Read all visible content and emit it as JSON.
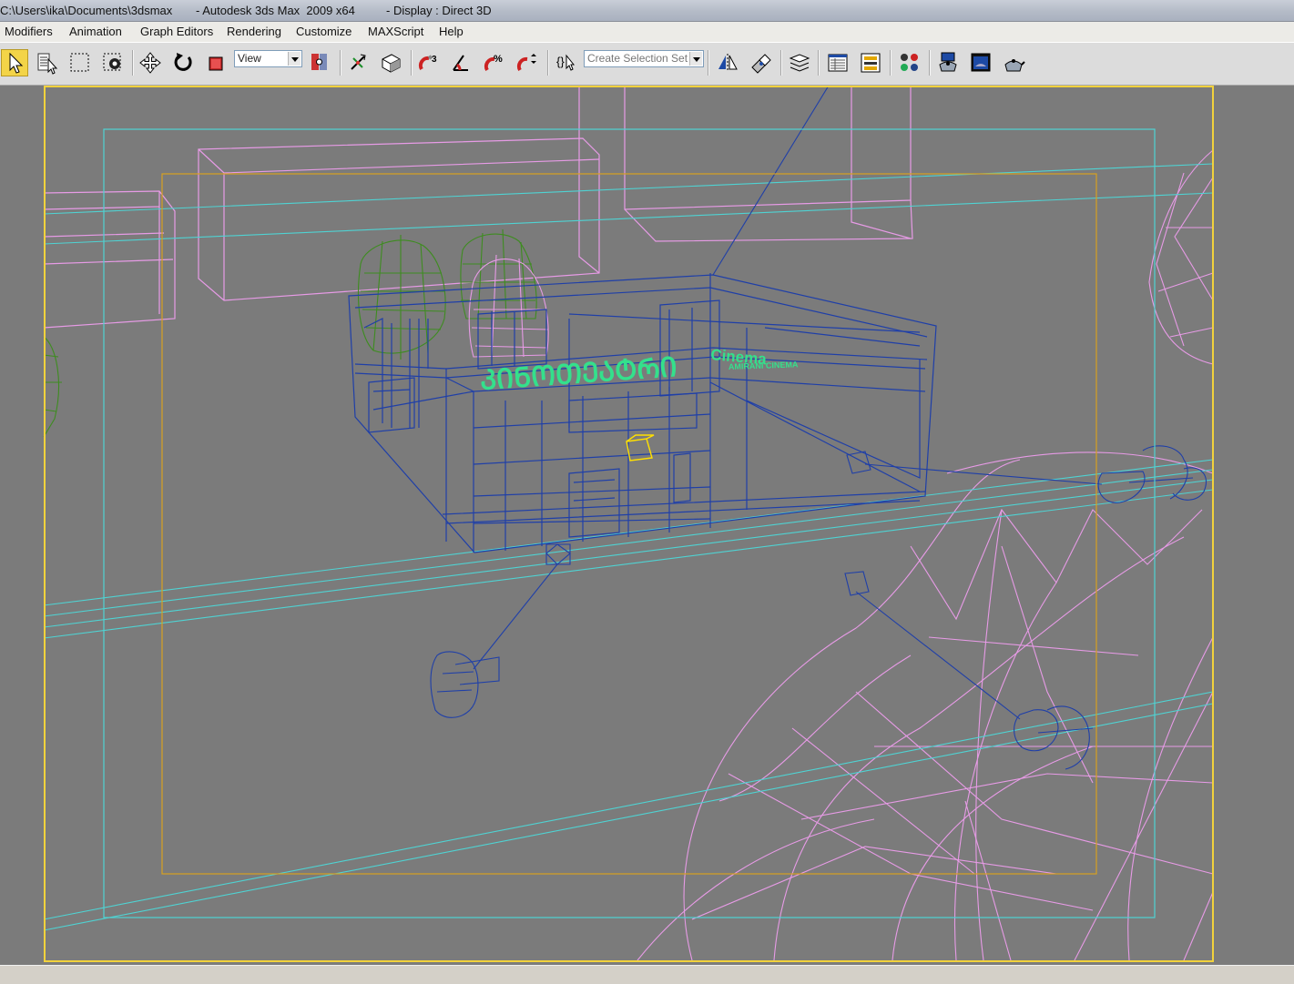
{
  "window": {
    "path": "C:\\Users\\ika\\Documents\\3dsmax",
    "app": "- Autodesk 3ds Max  2009 x64",
    "display": "- Display : Direct 3D"
  },
  "menu": {
    "items": [
      "Modifiers",
      "Animation",
      "Graph Editors",
      "Rendering",
      "Customize",
      "MAXScript",
      "Help"
    ]
  },
  "toolbar": {
    "reference_coordinate": "View",
    "selection_set_placeholder": "Create Selection Set",
    "icons": [
      "select-object-icon",
      "select-by-name-icon",
      "rectangular-selection-icon",
      "window-crossing-icon",
      "select-and-move-icon",
      "select-and-rotate-icon",
      "select-and-scale-icon",
      "use-pivot-center-icon",
      "select-and-manipulate-icon",
      "keyboard-shortcut-override-icon",
      "snaps-toggle-icon",
      "angle-snap-icon",
      "percent-snap-icon",
      "spinner-snap-icon",
      "edit-named-selection-icon",
      "mirror-icon",
      "align-icon",
      "layer-manager-icon",
      "curve-editor-icon",
      "schematic-view-icon",
      "material-editor-icon",
      "render-setup-icon",
      "rendered-frame-window-icon",
      "quick-render-icon"
    ]
  },
  "viewport": {
    "signage": {
      "georgian_sign": "ᲙᲘᲜᲝᲗᲔᲐᲢᲠᲘ",
      "cinema_label": "Cinema",
      "cinema_sub": "AMIRANI CINEMA"
    },
    "colors": {
      "background": "#7b7b7b",
      "safe_frame_outer": "#f2d23c",
      "safe_frame_action": "#4fd3d3",
      "safe_frame_title": "#d8a020",
      "building_wire": "#1f3fa8",
      "tree_wire": "#e79be6",
      "green_tree_wire": "#3e8c20",
      "sign_text": "#34e08c",
      "selected_object": "#ffe000"
    }
  }
}
